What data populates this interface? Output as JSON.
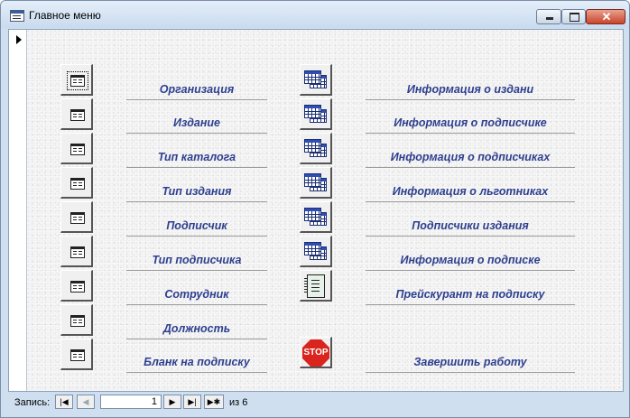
{
  "window": {
    "title": "Главное меню",
    "close_glyph": "✕"
  },
  "menu": {
    "left_items": [
      {
        "label": "Организация",
        "icon": "form-icon"
      },
      {
        "label": "Издание",
        "icon": "form-icon"
      },
      {
        "label": "Тип каталога",
        "icon": "form-icon"
      },
      {
        "label": "Тип издания",
        "icon": "form-icon"
      },
      {
        "label": "Подписчик",
        "icon": "form-icon"
      },
      {
        "label": "Тип подписчика",
        "icon": "form-icon"
      },
      {
        "label": "Сотрудник",
        "icon": "form-icon"
      },
      {
        "label": "Должность",
        "icon": "form-icon"
      },
      {
        "label": "Бланк на подписку",
        "icon": "form-icon"
      }
    ],
    "right_items": [
      {
        "label": "Информация о издани",
        "icon": "table-icon"
      },
      {
        "label": "Информация о подписчике",
        "icon": "table-icon"
      },
      {
        "label": "Информация о подписчиках",
        "icon": "table-icon"
      },
      {
        "label": "Информация о льготниках",
        "icon": "table-icon"
      },
      {
        "label": "Подписчики издания",
        "icon": "table-icon"
      },
      {
        "label": "Информация о подписке",
        "icon": "table-icon"
      },
      {
        "label": "Прейскурант на подписку",
        "icon": "notebook-icon"
      }
    ],
    "exit": {
      "label": "Завершить работу",
      "icon": "stop-icon",
      "icon_text": "STOP"
    }
  },
  "nav": {
    "label": "Запись:",
    "first": "|◀",
    "prev": "◀",
    "current": "1",
    "next": "▶",
    "last": "▶|",
    "new": "▶✱",
    "of_text": "из  6"
  },
  "colors": {
    "label_text": "#2e3f8f",
    "stop_red": "#d9251d"
  }
}
